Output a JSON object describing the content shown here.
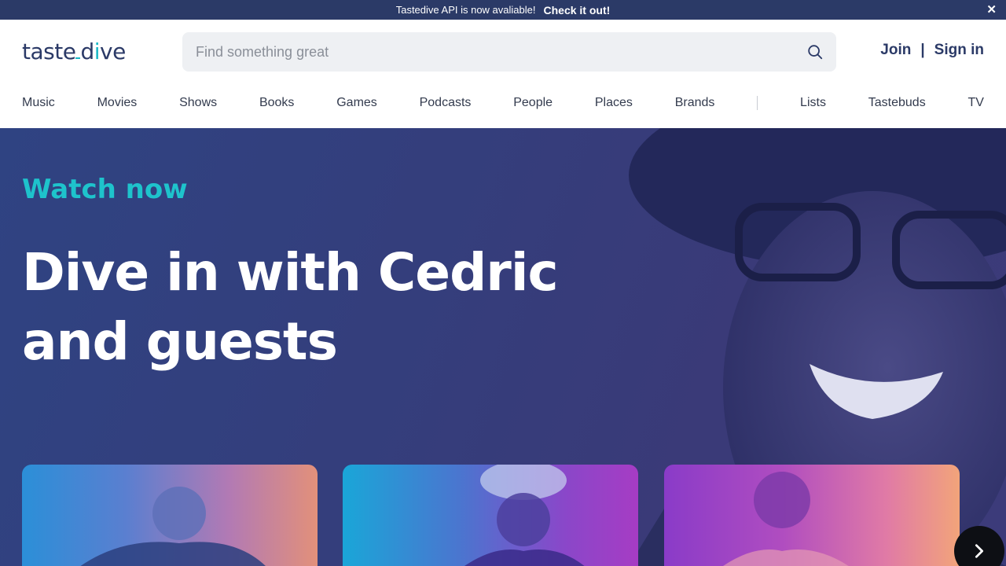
{
  "banner": {
    "message": "Tastedive API is now avaliable!",
    "cta": "Check it out!",
    "close_label": "✕"
  },
  "header": {
    "logo_text_pre": "taste",
    "logo_text_mid": "d",
    "logo_text_accent": "i",
    "logo_text_post": "ve",
    "search_placeholder": "Find something great",
    "join_label": "Join",
    "separator": "|",
    "signin_label": "Sign in"
  },
  "nav": {
    "items": [
      "Music",
      "Movies",
      "Shows",
      "Books",
      "Games",
      "Podcasts",
      "People",
      "Places",
      "Brands",
      "Lists",
      "Tastebuds",
      "TV"
    ]
  },
  "hero": {
    "eyebrow": "Watch now",
    "headline": "Dive in with Cedric and guests"
  },
  "carousel": {
    "cards": [
      "episode-card-1",
      "episode-card-2",
      "episode-card-3"
    ],
    "next_icon": "chevron-right-icon"
  },
  "colors": {
    "banner_bg": "#2b3a67",
    "brand_navy": "#2b3a67",
    "accent_teal": "#1ec3cc",
    "hero_bg": "#343e7c"
  }
}
